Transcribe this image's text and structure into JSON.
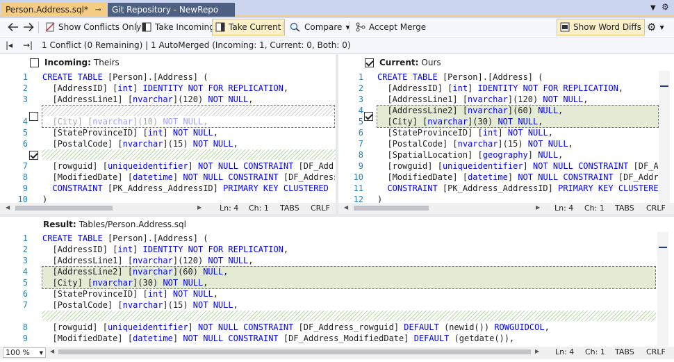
{
  "tabs": [
    {
      "label": "Person.Address.sql*",
      "active": true
    },
    {
      "label": "Git Repository - NewRepo",
      "active": false
    }
  ],
  "toolbar": {
    "show_conflicts_only": "Show Conflicts Only",
    "take_incoming": "Take Incoming",
    "take_current": "Take Current",
    "compare": "Compare",
    "accept_merge": "Accept Merge",
    "show_word_diffs": "Show Word Diffs"
  },
  "summary": "1 Conflict (0 Remaining) | 1 AutoMerged (Incoming: 1, Current: 0, Both: 0)",
  "incoming": {
    "label": "Incoming:",
    "source": "Theirs",
    "checked": false,
    "lines": [
      {
        "n": "1",
        "t": "CREATE TABLE [Person].[Address] ("
      },
      {
        "n": "2",
        "t": "  [AddressID] [int] IDENTITY NOT FOR REPLICATION,"
      },
      {
        "n": "3",
        "t": "  [AddressLine1] [nvarchar](120) NOT NULL,"
      },
      {
        "n": "4",
        "t": "  [City] [nvarchar](10) NOT NULL,"
      },
      {
        "n": "5",
        "t": "  [StateProvinceID] [int] NOT NULL,"
      },
      {
        "n": "6",
        "t": "  [PostalCode] [nvarchar](15) NOT NULL,"
      },
      {
        "n": "7",
        "t": "  [rowguid] [uniqueidentifier] NOT NULL CONSTRAINT [DF_Address_"
      },
      {
        "n": "8",
        "t": "  [ModifiedDate] [datetime] NOT NULL CONSTRAINT [DF_Address_M"
      },
      {
        "n": "9",
        "t": "  CONSTRAINT [PK_Address_AddressID] PRIMARY KEY CLUSTERED ([A"
      },
      {
        "n": "10",
        "t": ")"
      }
    ],
    "status": {
      "ln": "Ln: 4",
      "ch": "Ch: 1",
      "tabs": "TABS",
      "eol": "CRLF"
    }
  },
  "current": {
    "label": "Current:",
    "source": "Ours",
    "checked": true,
    "lines": [
      {
        "n": "1",
        "t": "CREATE TABLE [Person].[Address] ("
      },
      {
        "n": "2",
        "t": "  [AddressID] [int] IDENTITY NOT FOR REPLICATION,"
      },
      {
        "n": "3",
        "t": "  [AddressLine1] [nvarchar](120) NOT NULL,"
      },
      {
        "n": "4",
        "t": "  [AddressLine2] [nvarchar](60) NULL,"
      },
      {
        "n": "5",
        "t": "  [City] [nvarchar](30) NOT NULL,"
      },
      {
        "n": "6",
        "t": "  [StateProvinceID] [int] NOT NULL,"
      },
      {
        "n": "7",
        "t": "  [PostalCode] [nvarchar](15) NOT NULL,"
      },
      {
        "n": "8",
        "t": "  [SpatialLocation] [geography] NULL,"
      },
      {
        "n": "9",
        "t": "  [rowguid] [uniqueidentifier] NOT NULL CONSTRAINT [DF_Add"
      },
      {
        "n": "10",
        "t": "  [ModifiedDate] [datetime] NOT NULL CONSTRAINT [DF_Address"
      },
      {
        "n": "11",
        "t": "  CONSTRAINT [PK_Address_AddressID] PRIMARY KEY CLUSTERED"
      },
      {
        "n": "12",
        "t": ")"
      }
    ],
    "status": {
      "ln": "Ln: 4",
      "ch": "Ch: 1",
      "tabs": "TABS",
      "eol": "CRLF"
    }
  },
  "result": {
    "label": "Result:",
    "source": "Tables/Person.Address.sql",
    "lines": [
      {
        "n": "1",
        "t": "CREATE TABLE [Person].[Address] ("
      },
      {
        "n": "2",
        "t": "  [AddressID] [int] IDENTITY NOT FOR REPLICATION,"
      },
      {
        "n": "3",
        "t": "  [AddressLine1] [nvarchar](120) NOT NULL,"
      },
      {
        "n": "4",
        "t": "  [AddressLine2] [nvarchar](60) NULL,"
      },
      {
        "n": "5",
        "t": "  [City] [nvarchar](30) NOT NULL,"
      },
      {
        "n": "6",
        "t": "  [StateProvinceID] [int] NOT NULL,"
      },
      {
        "n": "7",
        "t": "  [PostalCode] [nvarchar](15) NOT NULL,"
      },
      {
        "n": "8",
        "t": "  [rowguid] [uniqueidentifier] NOT NULL CONSTRAINT [DF_Address_rowguid] DEFAULT (newid()) ROWGUIDCOL,"
      },
      {
        "n": "9",
        "t": "  [ModifiedDate] [datetime] NOT NULL CONSTRAINT [DF_Address_ModifiedDate] DEFAULT (getdate()),"
      }
    ],
    "zoom": "100 %",
    "status": {
      "ln": "Ln: 4",
      "ch": "Ch: 1",
      "tabs": "TABS",
      "eol": "CRLF"
    }
  },
  "keywords": [
    "CREATE",
    "TABLE",
    "int",
    "NOT",
    "NULL",
    "CONSTRAINT",
    "PRIMARY",
    "KEY",
    "nvarchar",
    "uniqueidentifier",
    "datetime",
    "geography",
    "IDENTITY",
    "FOR",
    "REPLICATION",
    "CLUSTERED",
    "DEFAULT",
    "ROWGUIDCOL"
  ],
  "icons": {
    "back": "arrow-left-icon",
    "forward": "arrow-right-icon",
    "first": "first-conflict-icon",
    "next": "next-conflict-icon",
    "settings": "gear-icon"
  },
  "colors": {
    "accent": "#f5cc84",
    "diff_highlight": "#e3ebd5",
    "line_numbers": "#2b7fb8",
    "keyword": "#0000ff"
  }
}
